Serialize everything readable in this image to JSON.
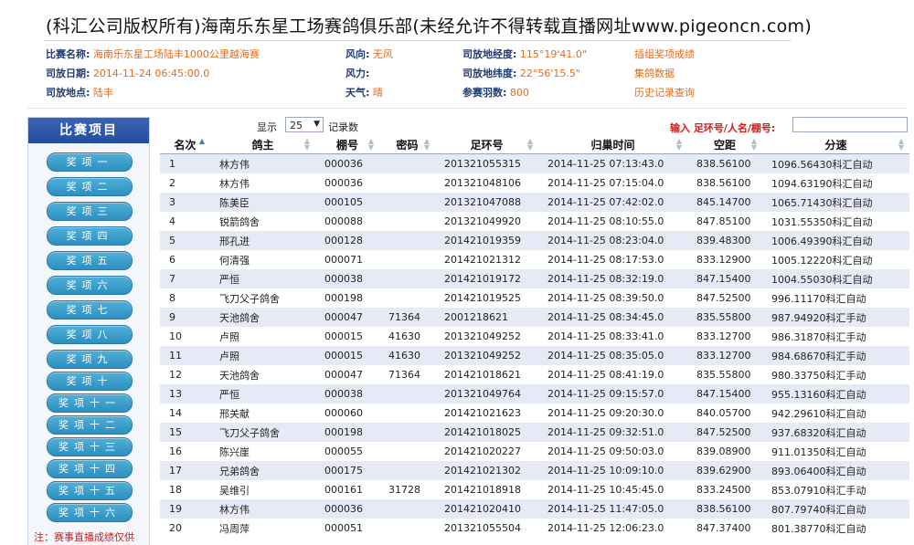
{
  "page_title": "(科汇公司版权所有)海南乐东星工场赛鸽俱乐部(未经允许不得转载直播网址www.pigeoncn.com)",
  "info": {
    "race_name_label": "比赛名称:",
    "race_name_value": "海南乐东星工场陆丰1000公里越海赛",
    "release_date_label": "司放日期:",
    "release_date_value": "2014-11-24 06:45:00.0",
    "release_place_label": "司放地点:",
    "release_place_value": "陆丰",
    "wind_dir_label": "风向:",
    "wind_dir_value": "无风",
    "wind_force_label": "风力:",
    "wind_force_value": "",
    "weather_label": "天气:",
    "weather_value": "晴",
    "longitude_label": "司放地经度:",
    "longitude_value": "115°19'41.0\"",
    "latitude_label": "司放地纬度:",
    "latitude_value": "22°56'15.5\"",
    "entries_label": "参赛羽数:",
    "entries_value": "800",
    "link_insert_group": "插组奖项成绩",
    "link_group_data": "集鸽数据",
    "link_history": "历史记录查询"
  },
  "sidebar": {
    "title": "比赛项目",
    "items": [
      "奖项一",
      "奖项二",
      "奖项三",
      "奖项四",
      "奖项五",
      "奖项六",
      "奖项七",
      "奖项八",
      "奖项九",
      "奖项十",
      "奖项十一",
      "奖项十二",
      "奖项十三",
      "奖项十四",
      "奖项十五",
      "奖项十六"
    ],
    "note": "注：赛事直播成绩仅供"
  },
  "grid": {
    "show_label": "显示",
    "page_size": "25",
    "records_label": "记录数",
    "search_label": "输入 足环号/人名/棚号:",
    "search_value": "",
    "columns": [
      "名次",
      "鸽主",
      "棚号",
      "密码",
      "足环号",
      "归巢时间",
      "空距",
      "分速"
    ],
    "rows": [
      [
        "1",
        "林方伟",
        "000036",
        "",
        "201321055315",
        "2014-11-25 07:13:43.0",
        "838.56100",
        "1096.56430科汇自动"
      ],
      [
        "2",
        "林方伟",
        "000036",
        "",
        "201321048106",
        "2014-11-25 07:15:04.0",
        "838.56100",
        "1094.63190科汇自动"
      ],
      [
        "3",
        "陈美臣",
        "000105",
        "",
        "201321047088",
        "2014-11-25 07:42:02.0",
        "845.14700",
        "1065.71430科汇自动"
      ],
      [
        "4",
        "锐箭鸽舍",
        "000088",
        "",
        "201321049920",
        "2014-11-25 08:10:55.0",
        "847.85100",
        "1031.55350科汇自动"
      ],
      [
        "5",
        "邢孔进",
        "000128",
        "",
        "201421019359",
        "2014-11-25 08:23:04.0",
        "839.48300",
        "1006.49390科汇自动"
      ],
      [
        "6",
        "何清强",
        "000071",
        "",
        "201421021312",
        "2014-11-25 08:17:53.0",
        "833.12900",
        "1005.12220科汇自动"
      ],
      [
        "7",
        "严恒",
        "000038",
        "",
        "201421019172",
        "2014-11-25 08:32:19.0",
        "847.15400",
        "1004.55030科汇自动"
      ],
      [
        "8",
        "飞刀父子鸽舍",
        "000198",
        "",
        "201421019525",
        "2014-11-25 08:39:50.0",
        "847.52500",
        "996.11170科汇自动"
      ],
      [
        "9",
        "天池鸽舍",
        "000047",
        "71364",
        "2001218621",
        "2014-11-25 08:34:45.0",
        "835.55800",
        "987.94920科汇手动"
      ],
      [
        "10",
        "卢照",
        "000015",
        "41630",
        "201321049252",
        "2014-11-25 08:33:41.0",
        "833.12700",
        "986.31870科汇手动"
      ],
      [
        "11",
        "卢照",
        "000015",
        "41630",
        "201321049252",
        "2014-11-25 08:35:05.0",
        "833.12700",
        "984.68670科汇手动"
      ],
      [
        "12",
        "天池鸽舍",
        "000047",
        "71364",
        "201421018621",
        "2014-11-25 08:41:19.0",
        "835.55800",
        "980.33750科汇手动"
      ],
      [
        "13",
        "严恒",
        "000038",
        "",
        "201321049764",
        "2014-11-25 09:15:57.0",
        "847.15400",
        "955.13160科汇自动"
      ],
      [
        "14",
        "邢关献",
        "000060",
        "",
        "201421021623",
        "2014-11-25 09:20:30.0",
        "840.05700",
        "942.29610科汇自动"
      ],
      [
        "15",
        "飞刀父子鸽舍",
        "000198",
        "",
        "201421018025",
        "2014-11-25 09:32:51.0",
        "847.52500",
        "937.68320科汇自动"
      ],
      [
        "16",
        "陈兴崖",
        "000055",
        "",
        "201421020227",
        "2014-11-25 09:50:03.0",
        "839.08900",
        "911.01350科汇自动"
      ],
      [
        "17",
        "兄弟鸽舍",
        "000175",
        "",
        "201421021302",
        "2014-11-25 10:09:10.0",
        "839.62900",
        "893.06400科汇自动"
      ],
      [
        "18",
        "吴维引",
        "000161",
        "31728",
        "201421018918",
        "2014-11-25 10:45:45.0",
        "833.24500",
        "853.07910科汇手动"
      ],
      [
        "19",
        "林方伟",
        "000036",
        "",
        "201421020410",
        "2014-11-25 11:47:05.0",
        "838.56100",
        "807.79740科汇自动"
      ],
      [
        "20",
        "冯周萍",
        "000051",
        "",
        "201321055504",
        "2014-11-25 12:06:23.0",
        "847.37400",
        "801.38770科汇自动"
      ]
    ]
  }
}
